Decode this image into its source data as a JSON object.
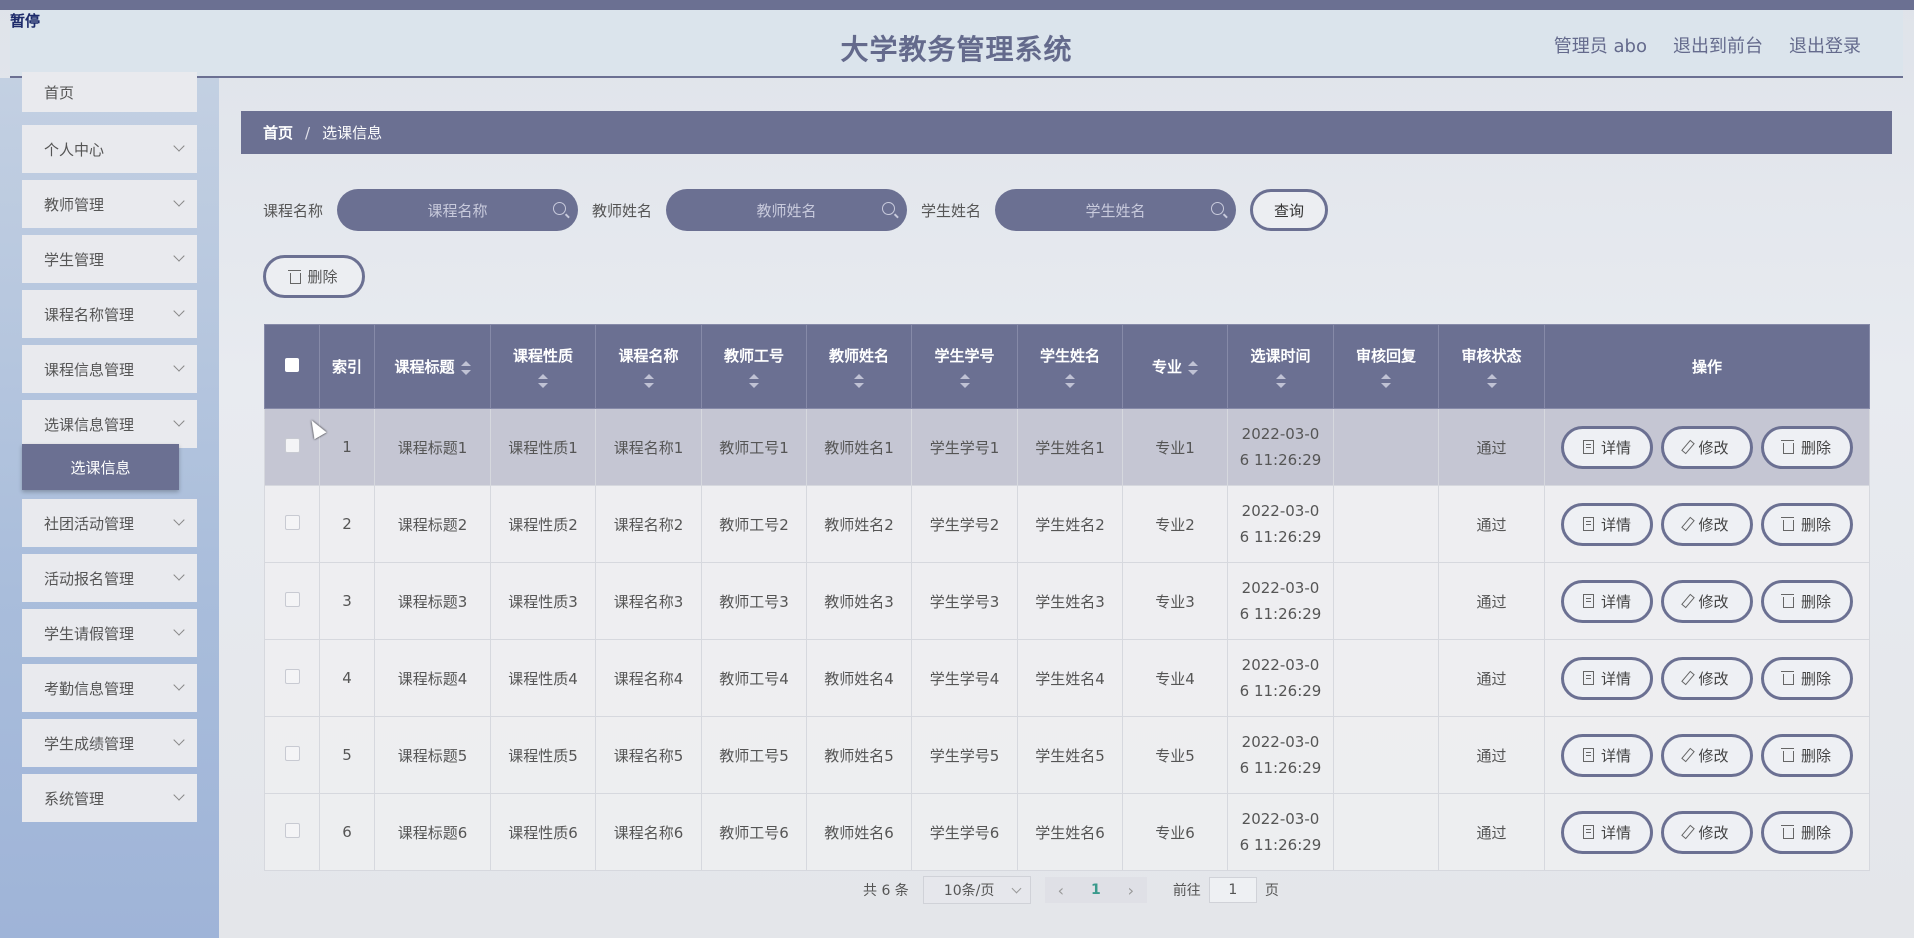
{
  "header": {
    "pause_label": "暂停",
    "title": "大学教务管理系统",
    "links": [
      "管理员 abo",
      "退出到前台",
      "退出登录"
    ]
  },
  "sidebar": {
    "items": [
      {
        "label": "首页",
        "expandable": false
      },
      {
        "label": "个人中心",
        "expandable": true
      },
      {
        "label": "教师管理",
        "expandable": true
      },
      {
        "label": "学生管理",
        "expandable": true
      },
      {
        "label": "课程名称管理",
        "expandable": true
      },
      {
        "label": "课程信息管理",
        "expandable": true
      },
      {
        "label": "选课信息管理",
        "expandable": true
      },
      {
        "label": "社团活动管理",
        "expandable": true
      },
      {
        "label": "活动报名管理",
        "expandable": true
      },
      {
        "label": "学生请假管理",
        "expandable": true
      },
      {
        "label": "考勤信息管理",
        "expandable": true
      },
      {
        "label": "学生成绩管理",
        "expandable": true
      },
      {
        "label": "系统管理",
        "expandable": true
      }
    ],
    "active_submenu": "选课信息"
  },
  "breadcrumb": {
    "home": "首页",
    "sep": "/",
    "current": "选课信息"
  },
  "search": {
    "course_label": "课程名称",
    "course_placeholder": "课程名称",
    "teacher_label": "教师姓名",
    "teacher_placeholder": "教师姓名",
    "student_label": "学生姓名",
    "student_placeholder": "学生姓名",
    "query_label": "查询"
  },
  "toolbar": {
    "delete_label": "删除"
  },
  "table": {
    "columns": [
      "索引",
      "课程标题",
      "课程性质",
      "课程名称",
      "教师工号",
      "教师姓名",
      "学生学号",
      "学生姓名",
      "专业",
      "选课时间",
      "审核回复",
      "审核状态",
      "操作"
    ],
    "rows": [
      {
        "index": "1",
        "title": "课程标题1",
        "nature": "课程性质1",
        "course": "课程名称1",
        "teacher_id": "教师工号1",
        "teacher": "教师姓名1",
        "student_id": "学生学号1",
        "student": "学生姓名1",
        "major": "专业1",
        "time_a": "2022-03-0",
        "time_b": "6 11:26:29",
        "reply": "",
        "status": "通过"
      },
      {
        "index": "2",
        "title": "课程标题2",
        "nature": "课程性质2",
        "course": "课程名称2",
        "teacher_id": "教师工号2",
        "teacher": "教师姓名2",
        "student_id": "学生学号2",
        "student": "学生姓名2",
        "major": "专业2",
        "time_a": "2022-03-0",
        "time_b": "6 11:26:29",
        "reply": "",
        "status": "通过"
      },
      {
        "index": "3",
        "title": "课程标题3",
        "nature": "课程性质3",
        "course": "课程名称3",
        "teacher_id": "教师工号3",
        "teacher": "教师姓名3",
        "student_id": "学生学号3",
        "student": "学生姓名3",
        "major": "专业3",
        "time_a": "2022-03-0",
        "time_b": "6 11:26:29",
        "reply": "",
        "status": "通过"
      },
      {
        "index": "4",
        "title": "课程标题4",
        "nature": "课程性质4",
        "course": "课程名称4",
        "teacher_id": "教师工号4",
        "teacher": "教师姓名4",
        "student_id": "学生学号4",
        "student": "学生姓名4",
        "major": "专业4",
        "time_a": "2022-03-0",
        "time_b": "6 11:26:29",
        "reply": "",
        "status": "通过"
      },
      {
        "index": "5",
        "title": "课程标题5",
        "nature": "课程性质5",
        "course": "课程名称5",
        "teacher_id": "教师工号5",
        "teacher": "教师姓名5",
        "student_id": "学生学号5",
        "student": "学生姓名5",
        "major": "专业5",
        "time_a": "2022-03-0",
        "time_b": "6 11:26:29",
        "reply": "",
        "status": "通过"
      },
      {
        "index": "6",
        "title": "课程标题6",
        "nature": "课程性质6",
        "course": "课程名称6",
        "teacher_id": "教师工号6",
        "teacher": "教师姓名6",
        "student_id": "学生学号6",
        "student": "学生姓名6",
        "major": "专业6",
        "time_a": "2022-03-0",
        "time_b": "6 11:26:29",
        "reply": "",
        "status": "通过"
      }
    ],
    "actions": {
      "detail": "详情",
      "edit": "修改",
      "delete": "删除"
    }
  },
  "pagination": {
    "total": "共 6 条",
    "page_size": "10条/页",
    "prev": "‹",
    "current_page": "1",
    "next": "›",
    "goto_label": "前往",
    "goto_value": "1",
    "page_suffix": "页"
  },
  "colors": {
    "accent": "#6b7092",
    "header_bg": "#dbe4ec",
    "sidebar_bg": "#a9bddb"
  }
}
